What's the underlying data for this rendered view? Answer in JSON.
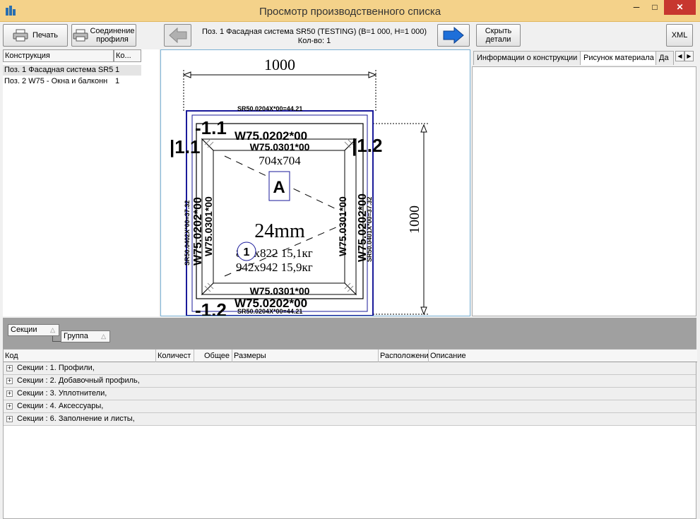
{
  "window": {
    "title": "Просмотр производственного списка",
    "buttons": {
      "minimize": "─",
      "maximize": "□",
      "close": "✕"
    }
  },
  "toolbar": {
    "print_label": "Печать",
    "join_profile_label_1": "Соединение",
    "join_profile_label_2": "профиля",
    "position_line": "Поз.  1  Фасадная система SR50 (TESTING) (B=1 000, H=1 000)",
    "quantity_line": "Кол-во: 1",
    "hide_details_label_1": "Скрыть",
    "hide_details_label_2": "детали",
    "xml_label": "XML",
    "prev_icon": "arrow-left-icon",
    "next_icon": "arrow-right-icon"
  },
  "constructions": {
    "columns": [
      "Конструкция",
      "Ко..."
    ],
    "rows": [
      {
        "name": "Поз.  1  Фасадная система SR5",
        "qty": "1"
      },
      {
        "name": "Поз.  2  W75 - Окна и балконн",
        "qty": "1"
      }
    ]
  },
  "drawing": {
    "width_dim": "1000",
    "height_dim": "1000",
    "top_outer_frame": "SR50.0204X*00=44.21",
    "top_frame": "W75.0202*00",
    "top_sash": "W75.0301*00",
    "bottom_sash": "W75.0301*00",
    "bottom_frame": "W75.0202*00",
    "bottom_outer_frame": "SR50.0204X*00=44.21",
    "left_outer_frame": "SR50.0402X*00=37.32",
    "left_frame": "W75.0202*00",
    "left_sash": "W75.0301*00",
    "right_sash": "W75.0301*00",
    "right_frame": "W75.0202*00",
    "right_outer_frame": "SR50.0401X*00=37.32",
    "label_top": "-1.1",
    "label_bottom": "-1.2",
    "label_left": "|1.1",
    "label_right": "|1.2",
    "opening_size": "704x704",
    "opening_type": "A",
    "glass_thickness": "24mm",
    "glass_number": "1",
    "glass_line_1": "822x822 15,1кг",
    "glass_line_2": "942x942 15,9кг"
  },
  "side_tabs": {
    "tabs": [
      "Информации о конструкции",
      "Рисунок материала",
      "Да"
    ],
    "active": "Рисунок материала"
  },
  "grouping": {
    "chips": [
      "Секции",
      "Группа"
    ]
  },
  "details": {
    "columns": [
      "Код",
      "Количест",
      "Общее",
      "Размеры",
      "Расположени",
      "Описание"
    ],
    "rows": [
      "Секции :  1. Профили,",
      "Секции :  2. Добавочный профиль,",
      "Секции :  3. Уплотнители,",
      "Секции :  4. Аксессуары,",
      "Секции :  6. Заполнение и листы,"
    ]
  }
}
